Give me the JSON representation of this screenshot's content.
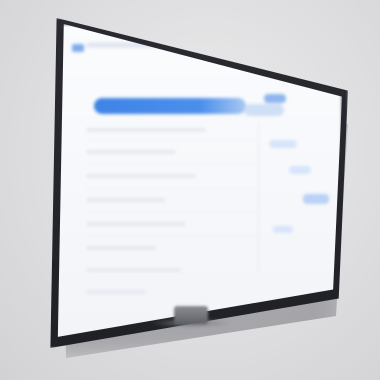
{
  "scene": {
    "subject": "wall-mounted-monitor",
    "screen_style": "blurred-dashboard",
    "colors": {
      "background": "#dedee0",
      "bezel": "#232428",
      "screen": "#f7f9fc",
      "accent": "#4b8fec",
      "accent_light": "#cfdff5"
    }
  }
}
